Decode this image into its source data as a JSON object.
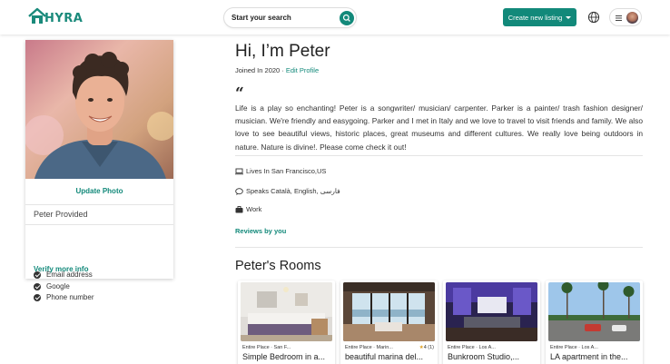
{
  "header": {
    "logo_text": "HYRA",
    "search_placeholder": "Start your search",
    "create_listing": "Create new listing",
    "icons": [
      "house-logo-icon",
      "search-icon",
      "caret-down-icon",
      "globe-icon",
      "hamburger-icon",
      "avatar"
    ]
  },
  "colors": {
    "accent": "#12897a",
    "text": "#222222"
  },
  "profile": {
    "update_photo": "Update Photo",
    "provided_title": "Peter Provided",
    "verified_items": [
      "Email address",
      "Google",
      "Phone number"
    ],
    "verify_more": "Verify more info"
  },
  "main": {
    "greeting": "Hi, I’m Peter",
    "joined": "Joined In 2020 · ",
    "edit_profile": "Edit Profile",
    "bio": "Life is a play so enchanting! Peter is a songwriter/ musician/ carpenter. Parker is a painter/ trash fashion designer/ musician. We're friendly and easygoing. Parker and I met in Italy and we love to travel to visit friends and family. We also love to see beautiful views, historic places, great museums and different cultures. We really love being outdoors in nature. Nature is divine!. Please come check it out!",
    "lives_in": "Lives In San Francisco,US",
    "speaks": "Speaks Català, English, فارسی",
    "work": "Work",
    "reviews": "Reviews by you",
    "rooms_title": "Peter's Rooms"
  },
  "rooms": [
    {
      "meta": "Entire Place · San F...",
      "title": "Simple Bedroom in a...",
      "rating": ""
    },
    {
      "meta": "Entire Place · Marin...",
      "title": "beautiful marina del...",
      "rating": "4 (1)"
    },
    {
      "meta": "Entire Place · Los A...",
      "title": "Bunkroom Studio,...",
      "rating": ""
    },
    {
      "meta": "Entire Place · Los A...",
      "title": "LA apartment in the...",
      "rating": ""
    }
  ]
}
